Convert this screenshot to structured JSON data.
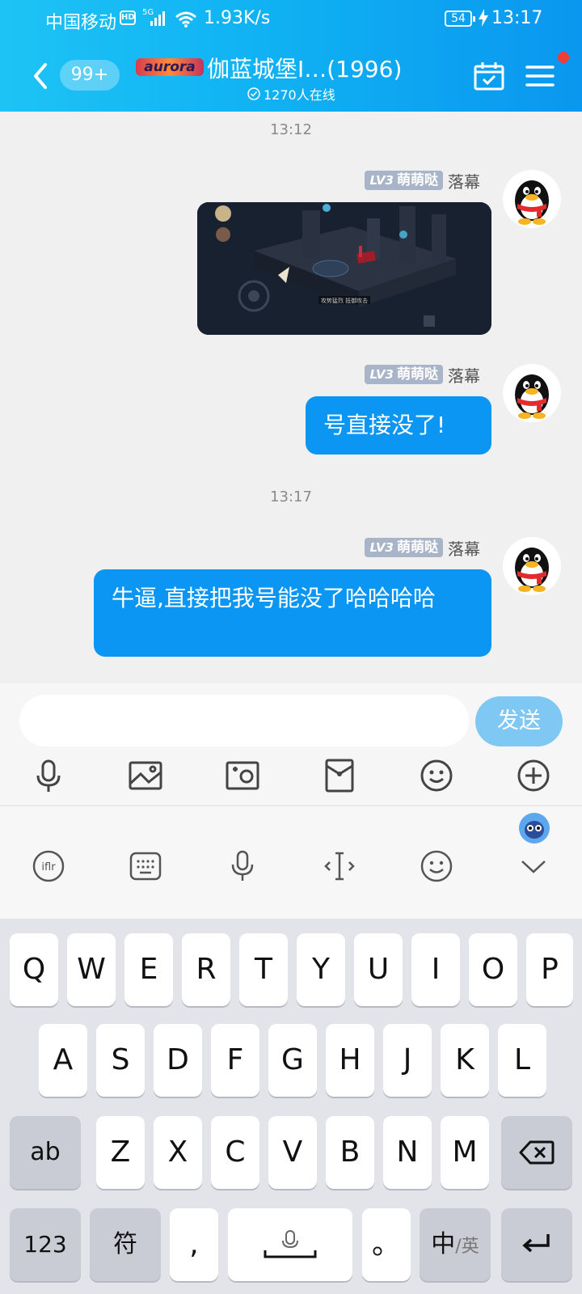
{
  "status_bar": {
    "carrier": "中国移动",
    "hd": "HD",
    "network": "5G",
    "speed": "1.93K/s",
    "battery": "54",
    "time": "13:17"
  },
  "header": {
    "unread_count": "99+",
    "logo_text": "aurora",
    "group_name": "伽蓝城堡I…(1996)",
    "online_count": "1270人在线",
    "notification_dot": true
  },
  "messages": [
    {
      "type": "time",
      "text": "13:12"
    },
    {
      "type": "image",
      "level_label": "LV3",
      "badge_text": "萌萌哒",
      "sender": "落幕",
      "image_caption": "伽蓝城堡游戏截图",
      "image_banner": "攻势猛烈 抵御攻击"
    },
    {
      "type": "text",
      "level_label": "LV3",
      "badge_text": "萌萌哒",
      "sender": "落幕",
      "text": "号直接没了!"
    },
    {
      "type": "time",
      "text": "13:17"
    },
    {
      "type": "text",
      "level_label": "LV3",
      "badge_text": "萌萌哒",
      "sender": "落幕",
      "text": "牛逼,直接把我号能没了哈哈哈哈"
    }
  ],
  "input": {
    "value": "",
    "placeholder": "",
    "send_label": "发送"
  },
  "tools": [
    "microphone-icon",
    "image-icon",
    "camera-icon",
    "red-packet-icon",
    "emoji-icon",
    "plus-icon"
  ],
  "keyboard_toolbar": [
    "ifly-icon",
    "keyboard-icon",
    "voice-icon",
    "cursor-icon",
    "emoji-icon",
    "collapse-icon"
  ],
  "keyboard": {
    "row1": [
      "Q",
      "W",
      "E",
      "R",
      "T",
      "Y",
      "U",
      "I",
      "O",
      "P"
    ],
    "row2": [
      "A",
      "S",
      "D",
      "F",
      "G",
      "H",
      "J",
      "K",
      "L"
    ],
    "row3": [
      "Z",
      "X",
      "C",
      "V",
      "B",
      "N",
      "M"
    ],
    "shift_label": "ab",
    "numbers_label": "123",
    "symbols_label": "符",
    "comma_label": ",",
    "period_label": "。",
    "lang_label": "中",
    "lang_alt_label": "/英"
  },
  "colors": {
    "header_start": "#1ec3f5",
    "header_end": "#0a97ef",
    "bubble": "#0a96f2",
    "send_button": "#7fc8f4",
    "badge": "#a8b4c8"
  }
}
